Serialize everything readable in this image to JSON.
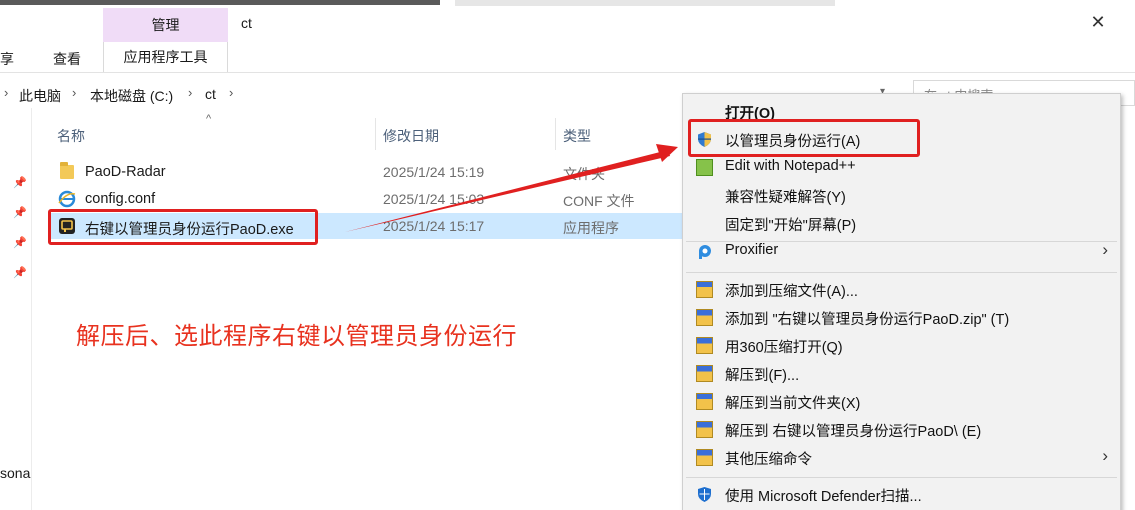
{
  "window": {
    "title": "ct"
  },
  "ribbon": {
    "contextual_group": "管理",
    "tabs": [
      {
        "label": "享"
      },
      {
        "label": "查看"
      },
      {
        "label": "应用程序工具"
      }
    ]
  },
  "address": {
    "parts": [
      "此电脑",
      "本地磁盘 (C:)",
      "ct"
    ],
    "search_placeholder": "在 ct 中搜索"
  },
  "nav": {
    "partial_label": "sona"
  },
  "columns": {
    "name": "名称",
    "date": "修改日期",
    "type": "类型"
  },
  "files": [
    {
      "name": "PaoD-Radar",
      "date": "2025/1/24 15:19",
      "type": "文件夹",
      "icon": "folder-icon"
    },
    {
      "name": "config.conf",
      "date": "2025/1/24 15:03",
      "type": "CONF 文件",
      "icon": "ie-file-icon"
    },
    {
      "name": "右键以管理员身份运行PaoD.exe",
      "date": "2025/1/24 15:17",
      "type": "应用程序",
      "icon": "exe-icon"
    }
  ],
  "annotation": "解压后、选此程序右键以管理员身份运行",
  "context_menu": {
    "items": [
      {
        "label": "打开(O)",
        "icon": "",
        "bold": true
      },
      {
        "label": "以管理员身份运行(A)",
        "icon": "uac-shield-icon"
      },
      {
        "label": "Edit with Notepad++",
        "icon": "notepadpp-icon"
      },
      {
        "label": "兼容性疑难解答(Y)",
        "icon": ""
      },
      {
        "label": "固定到\"开始\"屏幕(P)",
        "icon": ""
      },
      {
        "label": "Proxifier",
        "icon": "proxifier-icon",
        "submenu": true
      },
      {
        "label": "添加到压缩文件(A)...",
        "icon": "archive-icon"
      },
      {
        "label": "添加到 \"右键以管理员身份运行PaoD.zip\" (T)",
        "icon": "archive-icon"
      },
      {
        "label": "用360压缩打开(Q)",
        "icon": "archive-icon"
      },
      {
        "label": "解压到(F)...",
        "icon": "archive-icon"
      },
      {
        "label": "解压到当前文件夹(X)",
        "icon": "archive-icon"
      },
      {
        "label": "解压到 右键以管理员身份运行PaoD\\ (E)",
        "icon": "archive-icon"
      },
      {
        "label": "其他压缩命令",
        "icon": "archive-icon",
        "submenu": true
      },
      {
        "label": "使用 Microsoft Defender扫描...",
        "icon": "defender-icon"
      }
    ]
  },
  "colors": {
    "highlight": "#e02020",
    "selection": "#cce8ff",
    "annotation": "#e8321f",
    "contextual_tab": "#f0dcf7"
  }
}
